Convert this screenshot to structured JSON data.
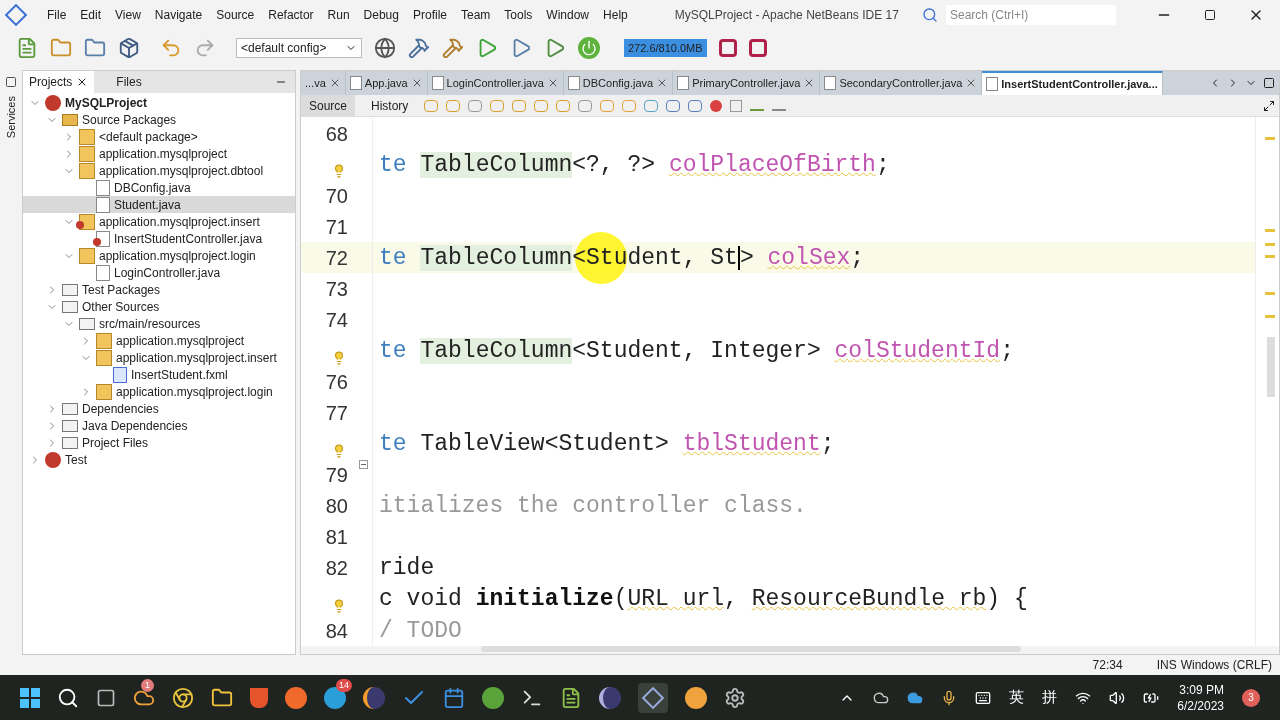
{
  "window": {
    "title": "MySQLProject - Apache NetBeans IDE 17",
    "search_placeholder": "Search (Ctrl+I)"
  },
  "menu": [
    "File",
    "Edit",
    "View",
    "Navigate",
    "Source",
    "Refactor",
    "Run",
    "Debug",
    "Profile",
    "Team",
    "Tools",
    "Window",
    "Help"
  ],
  "toolbar": {
    "config": "<default config>",
    "memory": "272.6/810.0MB"
  },
  "side_tabs": [
    {
      "label": "Projects",
      "selected": true
    },
    {
      "label": "Files",
      "selected": false
    }
  ],
  "services_label": "Services",
  "tree": [
    {
      "label": "MySQLProject",
      "kind": "project",
      "bold": true,
      "expanded": true,
      "selected": false,
      "children": [
        {
          "label": "Source Packages",
          "kind": "sources",
          "expanded": true,
          "selected": false,
          "children": [
            {
              "label": "<default package>",
              "kind": "package",
              "expanded": false,
              "selected": false
            },
            {
              "label": "application.mysqlproject",
              "kind": "package",
              "expanded": false,
              "selected": false
            },
            {
              "label": "application.mysqlproject.dbtool",
              "kind": "package",
              "expanded": true,
              "selected": false,
              "children": [
                {
                  "label": "DBConfig.java",
                  "kind": "java",
                  "selected": false
                },
                {
                  "label": "Student.java",
                  "kind": "java",
                  "selected": true
                }
              ]
            },
            {
              "label": "application.mysqlproject.insert",
              "kind": "package_error",
              "expanded": true,
              "selected": false,
              "children": [
                {
                  "label": "InsertStudentController.java",
                  "kind": "java_error",
                  "selected": false
                }
              ]
            },
            {
              "label": "application.mysqlproject.login",
              "kind": "package",
              "expanded": true,
              "selected": false,
              "children": [
                {
                  "label": "LoginController.java",
                  "kind": "java",
                  "selected": false
                }
              ]
            }
          ]
        },
        {
          "label": "Test Packages",
          "kind": "folder",
          "expanded": false,
          "selected": false
        },
        {
          "label": "Other Sources",
          "kind": "folder",
          "expanded": true,
          "selected": false,
          "children": [
            {
              "label": "src/main/resources",
              "kind": "folder",
              "expanded": true,
              "selected": false,
              "children": [
                {
                  "label": "application.mysqlproject",
                  "kind": "package",
                  "expanded": false,
                  "selected": false
                },
                {
                  "label": "application.mysqlproject.insert",
                  "kind": "package",
                  "expanded": true,
                  "selected": false,
                  "children": [
                    {
                      "label": "InsertStudent.fxml",
                      "kind": "fxml",
                      "selected": false
                    }
                  ]
                },
                {
                  "label": "application.mysqlproject.login",
                  "kind": "package",
                  "expanded": false,
                  "selected": false
                }
              ]
            }
          ]
        },
        {
          "label": "Dependencies",
          "kind": "folder",
          "expanded": false,
          "selected": false
        },
        {
          "label": "Java Dependencies",
          "kind": "folder",
          "expanded": false,
          "selected": false
        },
        {
          "label": "Project Files",
          "kind": "folder",
          "expanded": false,
          "selected": false
        }
      ]
    },
    {
      "label": "Test",
      "kind": "project",
      "bold": false,
      "expanded": false,
      "selected": false
    }
  ],
  "editor_tabs": [
    {
      "label": "...va",
      "icon": false,
      "selected": false
    },
    {
      "label": "App.java",
      "icon": true,
      "selected": false
    },
    {
      "label": "LoginController.java",
      "icon": true,
      "selected": false
    },
    {
      "label": "DBConfig.java",
      "icon": true,
      "selected": false
    },
    {
      "label": "PrimaryController.java",
      "icon": true,
      "selected": false
    },
    {
      "label": "SecondaryController.java",
      "icon": true,
      "selected": false
    },
    {
      "label": "InsertStudentController.java...",
      "icon": true,
      "selected": true
    }
  ],
  "editor_modes": [
    {
      "label": "Source",
      "selected": true
    },
    {
      "label": "History",
      "selected": false
    }
  ],
  "code": [
    {
      "kind": "number",
      "number": "68"
    },
    {
      "kind": "bulb",
      "segments": [
        {
          "kind": "keyword",
          "text": "te "
        },
        {
          "kind": "type",
          "text": "TableColumn"
        },
        {
          "kind": "plain",
          "text": "<?, ?> "
        },
        {
          "kind": "field",
          "text": "colPlaceOfBirth"
        },
        {
          "kind": "plain",
          "text": ";"
        }
      ]
    },
    {
      "kind": "number",
      "number": "70"
    },
    {
      "kind": "number",
      "number": "71"
    },
    {
      "kind": "number",
      "number": "72",
      "current": true,
      "segments": [
        {
          "kind": "keyword",
          "text": "te "
        },
        {
          "kind": "type",
          "text": "TableColumn"
        },
        {
          "kind": "plain",
          "text": "<Student, St"
        },
        {
          "kind": "caret"
        },
        {
          "kind": "plain",
          "text": "> "
        },
        {
          "kind": "field",
          "text": "colSex"
        },
        {
          "kind": "plain",
          "text": ";"
        }
      ]
    },
    {
      "kind": "number",
      "number": "73"
    },
    {
      "kind": "number",
      "number": "74"
    },
    {
      "kind": "bulb",
      "segments": [
        {
          "kind": "keyword",
          "text": "te "
        },
        {
          "kind": "type",
          "text": "TableColumn"
        },
        {
          "kind": "plain",
          "text": "<Student, Integer> "
        },
        {
          "kind": "field",
          "text": "colStudentId"
        },
        {
          "kind": "plain",
          "text": ";"
        }
      ]
    },
    {
      "kind": "number",
      "number": "76"
    },
    {
      "kind": "number",
      "number": "77"
    },
    {
      "kind": "bulb",
      "segments": [
        {
          "kind": "keyword",
          "text": "te "
        },
        {
          "kind": "plain",
          "text": "TableView<Student> "
        },
        {
          "kind": "field",
          "text": "tblStudent"
        },
        {
          "kind": "plain",
          "text": ";"
        }
      ]
    },
    {
      "kind": "number",
      "number": "79",
      "fold": true
    },
    {
      "kind": "number",
      "number": "80",
      "segments": [
        {
          "kind": "comment",
          "text": "itializes the controller class."
        }
      ]
    },
    {
      "kind": "number",
      "number": "81"
    },
    {
      "kind": "number",
      "number": "82",
      "segments": [
        {
          "kind": "plain",
          "text": "ride"
        }
      ]
    },
    {
      "kind": "bulb",
      "segments": [
        {
          "kind": "plain",
          "text": "c void "
        },
        {
          "kind": "bold",
          "text": "initialize"
        },
        {
          "kind": "plain",
          "text": "("
        },
        {
          "kind": "warn",
          "text": "URL url"
        },
        {
          "kind": "plain",
          "text": ", "
        },
        {
          "kind": "warn",
          "text": "ResourceBundle rb"
        },
        {
          "kind": "plain",
          "text": ") {"
        }
      ]
    },
    {
      "kind": "number",
      "number": "84",
      "segments": [
        {
          "kind": "comment",
          "text": "/ TODO"
        }
      ]
    }
  ],
  "status_bar": {
    "position": "72:34",
    "mode": "INS",
    "line_endings": "Windows (CRLF)"
  },
  "taskbar": {
    "badges": [
      "1",
      "14"
    ],
    "tray": [
      "英",
      "拼"
    ],
    "time": "3:09 PM",
    "date": "6/2/2023",
    "notifications": "3"
  }
}
